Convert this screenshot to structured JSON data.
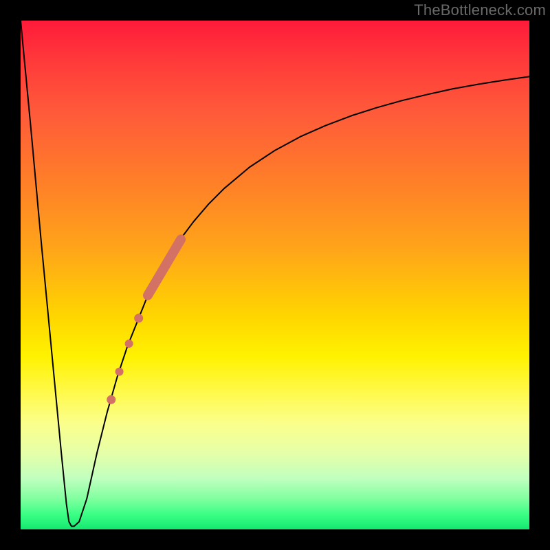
{
  "watermark": "TheBottleneck.com",
  "chart_data": {
    "type": "line",
    "title": "",
    "xlabel": "",
    "ylabel": "",
    "xlim": [
      0,
      100
    ],
    "ylim": [
      0,
      100
    ],
    "series": [
      {
        "name": "curve",
        "color": "#000000",
        "stroke_width": 2,
        "x": [
          0,
          2,
          4,
          6,
          8,
          8.5,
          9,
          9.5,
          10,
          10.5,
          11.5,
          13,
          15,
          17,
          19,
          21,
          23,
          25,
          28,
          31,
          34,
          37,
          40,
          45,
          50,
          55,
          60,
          65,
          70,
          75,
          80,
          85,
          90,
          95,
          100
        ],
        "y": [
          100,
          79,
          57,
          36,
          15,
          10,
          5,
          1.5,
          0.6,
          0.6,
          1.5,
          6,
          15,
          23,
          30,
          36,
          41,
          46,
          52,
          56.5,
          60.5,
          64,
          67,
          71.2,
          74.5,
          77.2,
          79.4,
          81.3,
          82.9,
          84.3,
          85.5,
          86.6,
          87.5,
          88.3,
          89
        ]
      }
    ],
    "markers": [
      {
        "name": "thick-segment",
        "shape": "line",
        "color": "#d47165",
        "stroke_width": 14,
        "linecap": "round",
        "x": [
          25,
          31.5
        ],
        "y": [
          46,
          57
        ]
      },
      {
        "name": "dot-1",
        "shape": "circle",
        "color": "#d47165",
        "r": 6.5,
        "x": 23.2,
        "y": 41.5
      },
      {
        "name": "dot-2",
        "shape": "circle",
        "color": "#d47165",
        "r": 6.0,
        "x": 21.3,
        "y": 36.5
      },
      {
        "name": "dot-3",
        "shape": "circle",
        "color": "#d47165",
        "r": 6.0,
        "x": 19.4,
        "y": 31
      },
      {
        "name": "dot-4",
        "shape": "circle",
        "color": "#d47165",
        "r": 6.5,
        "x": 17.8,
        "y": 25.5
      }
    ]
  }
}
